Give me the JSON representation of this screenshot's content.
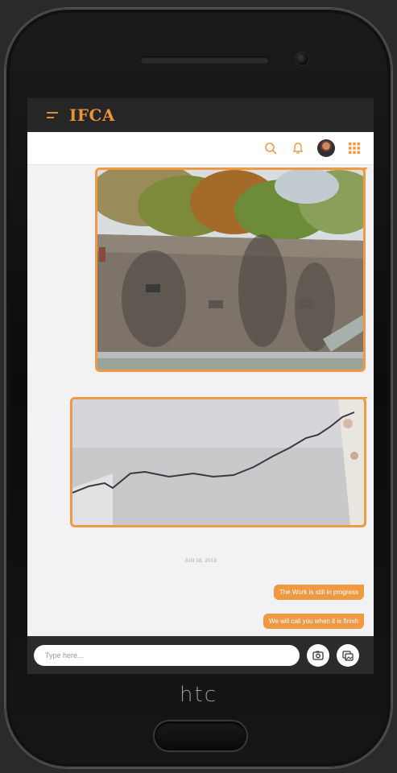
{
  "device": {
    "brand": "htc"
  },
  "app": {
    "logo": "IFCA"
  },
  "toolbar": {
    "icons": [
      "search-icon",
      "bell-icon",
      "avatar",
      "grid-icon"
    ]
  },
  "conversation": {
    "date_separator": "JUN 18, 2019",
    "messages": [
      {
        "type": "image",
        "content": "roof photo"
      },
      {
        "type": "image",
        "content": "wall crack photo"
      },
      {
        "type": "text",
        "text": "The Work is still in progress"
      },
      {
        "type": "text",
        "text": "We will call you when it is finish"
      }
    ]
  },
  "composer": {
    "placeholder": "Type here...",
    "buttons": [
      "camera-icon",
      "gallery-icon"
    ]
  },
  "colors": {
    "accent": "#ef9a43",
    "app_bar": "#262626",
    "chat_bg": "#f2f2f4"
  }
}
